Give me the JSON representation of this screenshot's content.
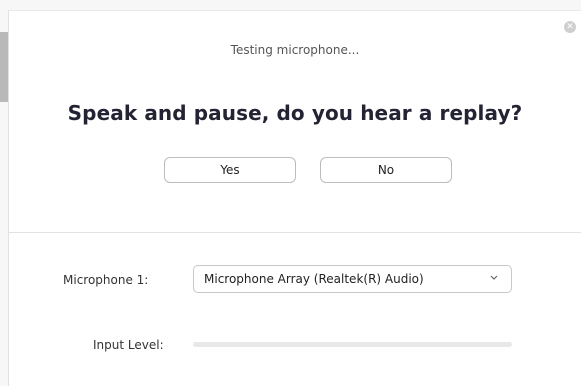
{
  "dialog": {
    "status_text": "Testing microphone...",
    "question": "Speak and pause, do you hear a replay?",
    "yes_label": "Yes",
    "no_label": "No",
    "close_icon": "close-icon"
  },
  "settings": {
    "microphone_label": "Microphone 1:",
    "microphone_value": "Microphone Array (Realtek(R) Audio)",
    "input_level_label": "Input Level:",
    "input_level_value": 0
  },
  "colors": {
    "accent": "#2d8cff",
    "text_dark": "#232333",
    "pointer_grey": "#b9b9b9"
  }
}
